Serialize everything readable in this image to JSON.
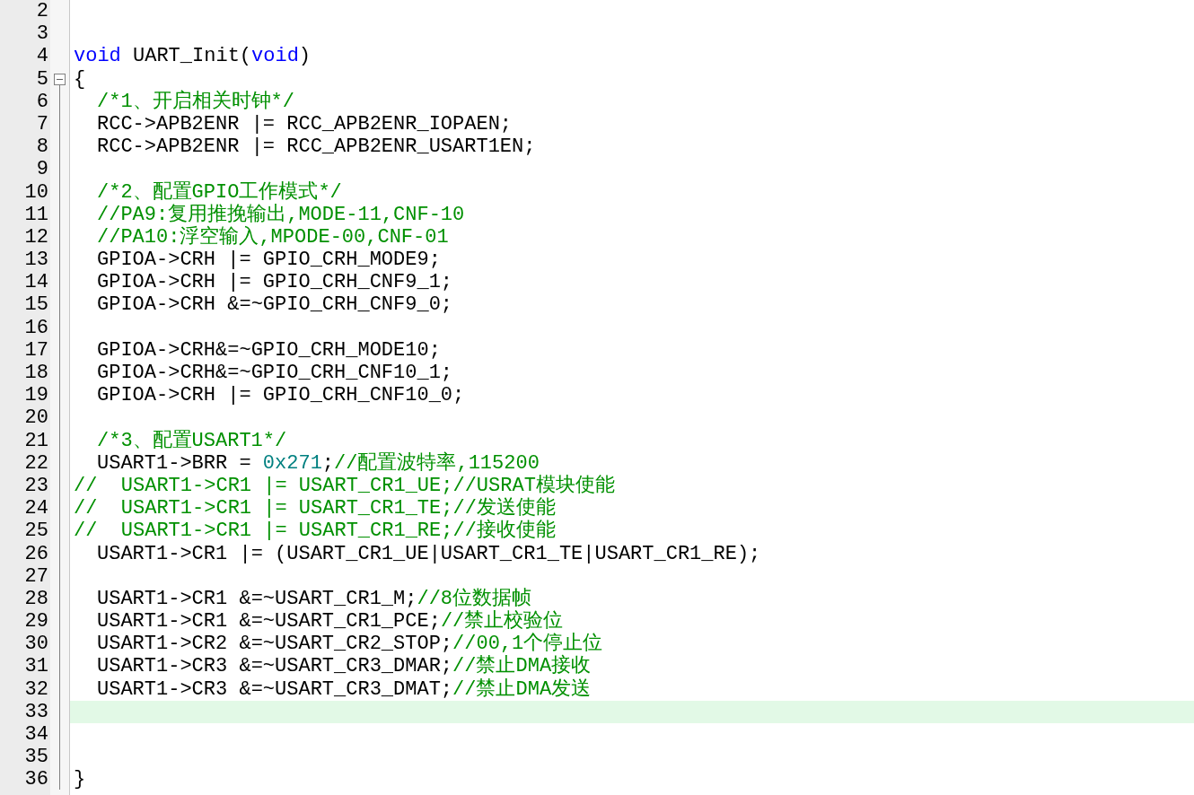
{
  "editor": {
    "lines": [
      {
        "number": "2",
        "current": false
      },
      {
        "number": "3",
        "current": false
      },
      {
        "number": "4",
        "indented": false,
        "current": false,
        "segments": [
          {
            "kind": "keyword",
            "text": "void"
          },
          {
            "kind": "plain",
            "text": " UART_Init("
          },
          {
            "kind": "keyword",
            "text": "void"
          },
          {
            "kind": "plain",
            "text": ")"
          }
        ]
      },
      {
        "number": "5",
        "indented": false,
        "current": false,
        "fold": {
          "expanded": true
        },
        "segments": [
          {
            "kind": "plain",
            "text": "{"
          }
        ]
      },
      {
        "number": "6",
        "indented": true,
        "current": false,
        "segments": [
          {
            "kind": "comment",
            "text": "/*1、开启相关时钟*/"
          }
        ]
      },
      {
        "number": "7",
        "indented": true,
        "current": false,
        "segments": [
          {
            "kind": "plain",
            "text": "RCC->APB2ENR |= RCC_APB2ENR_IOPAEN;"
          }
        ]
      },
      {
        "number": "8",
        "indented": true,
        "current": false,
        "segments": [
          {
            "kind": "plain",
            "text": "RCC->APB2ENR |= RCC_APB2ENR_USART1EN;"
          }
        ]
      },
      {
        "number": "9",
        "current": false
      },
      {
        "number": "10",
        "indented": true,
        "current": false,
        "segments": [
          {
            "kind": "comment",
            "text": "/*2、配置GPIO工作模式*/"
          }
        ]
      },
      {
        "number": "11",
        "indented": true,
        "current": false,
        "segments": [
          {
            "kind": "comment",
            "text": "//PA9:复用推挽输出,MODE-11,CNF-10"
          }
        ]
      },
      {
        "number": "12",
        "indented": true,
        "current": false,
        "segments": [
          {
            "kind": "comment",
            "text": "//PA10:浮空输入,MPODE-00,CNF-01"
          }
        ]
      },
      {
        "number": "13",
        "indented": true,
        "current": false,
        "segments": [
          {
            "kind": "plain",
            "text": "GPIOA->CRH |= GPIO_CRH_MODE9;"
          }
        ]
      },
      {
        "number": "14",
        "indented": true,
        "current": false,
        "segments": [
          {
            "kind": "plain",
            "text": "GPIOA->CRH |= GPIO_CRH_CNF9_1;"
          }
        ]
      },
      {
        "number": "15",
        "indented": true,
        "current": false,
        "segments": [
          {
            "kind": "plain",
            "text": "GPIOA->CRH &=~GPIO_CRH_CNF9_0;"
          }
        ]
      },
      {
        "number": "16",
        "current": false
      },
      {
        "number": "17",
        "indented": true,
        "current": false,
        "segments": [
          {
            "kind": "plain",
            "text": "GPIOA->CRH&=~GPIO_CRH_MODE10;"
          }
        ]
      },
      {
        "number": "18",
        "indented": true,
        "current": false,
        "segments": [
          {
            "kind": "plain",
            "text": "GPIOA->CRH&=~GPIO_CRH_CNF10_1;"
          }
        ]
      },
      {
        "number": "19",
        "indented": true,
        "current": false,
        "segments": [
          {
            "kind": "plain",
            "text": "GPIOA->CRH |= GPIO_CRH_CNF10_0;"
          }
        ]
      },
      {
        "number": "20",
        "current": false
      },
      {
        "number": "21",
        "indented": true,
        "current": false,
        "segments": [
          {
            "kind": "comment",
            "text": "/*3、配置USART1*/"
          }
        ]
      },
      {
        "number": "22",
        "indented": true,
        "current": false,
        "segments": [
          {
            "kind": "plain",
            "text": "USART1->BRR = "
          },
          {
            "kind": "number",
            "text": "0x271"
          },
          {
            "kind": "plain",
            "text": ";"
          },
          {
            "kind": "comment",
            "text": "//配置波特率,115200"
          }
        ]
      },
      {
        "number": "23",
        "indented": false,
        "current": false,
        "segments": [
          {
            "kind": "comment",
            "text": "//  USART1->CR1 |= USART_CR1_UE;//USRAT模块使能"
          }
        ]
      },
      {
        "number": "24",
        "indented": false,
        "current": false,
        "segments": [
          {
            "kind": "comment",
            "text": "//  USART1->CR1 |= USART_CR1_TE;//发送使能"
          }
        ]
      },
      {
        "number": "25",
        "indented": false,
        "current": false,
        "segments": [
          {
            "kind": "comment",
            "text": "//  USART1->CR1 |= USART_CR1_RE;//接收使能"
          }
        ]
      },
      {
        "number": "26",
        "indented": true,
        "current": false,
        "segments": [
          {
            "kind": "plain",
            "text": "USART1->CR1 |= (USART_CR1_UE|USART_CR1_TE|USART_CR1_RE);"
          }
        ]
      },
      {
        "number": "27",
        "current": false
      },
      {
        "number": "28",
        "indented": true,
        "current": false,
        "segments": [
          {
            "kind": "plain",
            "text": "USART1->CR1 &=~USART_CR1_M;"
          },
          {
            "kind": "comment",
            "text": "//8位数据帧"
          }
        ]
      },
      {
        "number": "29",
        "indented": true,
        "current": false,
        "segments": [
          {
            "kind": "plain",
            "text": "USART1->CR1 &=~USART_CR1_PCE;"
          },
          {
            "kind": "comment",
            "text": "//禁止校验位"
          }
        ]
      },
      {
        "number": "30",
        "indented": true,
        "current": false,
        "segments": [
          {
            "kind": "plain",
            "text": "USART1->CR2 &=~USART_CR2_STOP;"
          },
          {
            "kind": "comment",
            "text": "//00,1个停止位"
          }
        ]
      },
      {
        "number": "31",
        "indented": true,
        "current": false,
        "segments": [
          {
            "kind": "plain",
            "text": "USART1->CR3 &=~USART_CR3_DMAR;"
          },
          {
            "kind": "comment",
            "text": "//禁止DMA接收"
          }
        ]
      },
      {
        "number": "32",
        "indented": true,
        "current": false,
        "segments": [
          {
            "kind": "plain",
            "text": "USART1->CR3 &=~USART_CR3_DMAT;"
          },
          {
            "kind": "comment",
            "text": "//禁止DMA发送"
          }
        ]
      },
      {
        "number": "33",
        "current": true
      },
      {
        "number": "34",
        "current": false
      },
      {
        "number": "35",
        "current": false
      },
      {
        "number": "36",
        "indented": false,
        "current": false,
        "segments": [
          {
            "kind": "plain",
            "text": "}"
          }
        ]
      }
    ]
  }
}
